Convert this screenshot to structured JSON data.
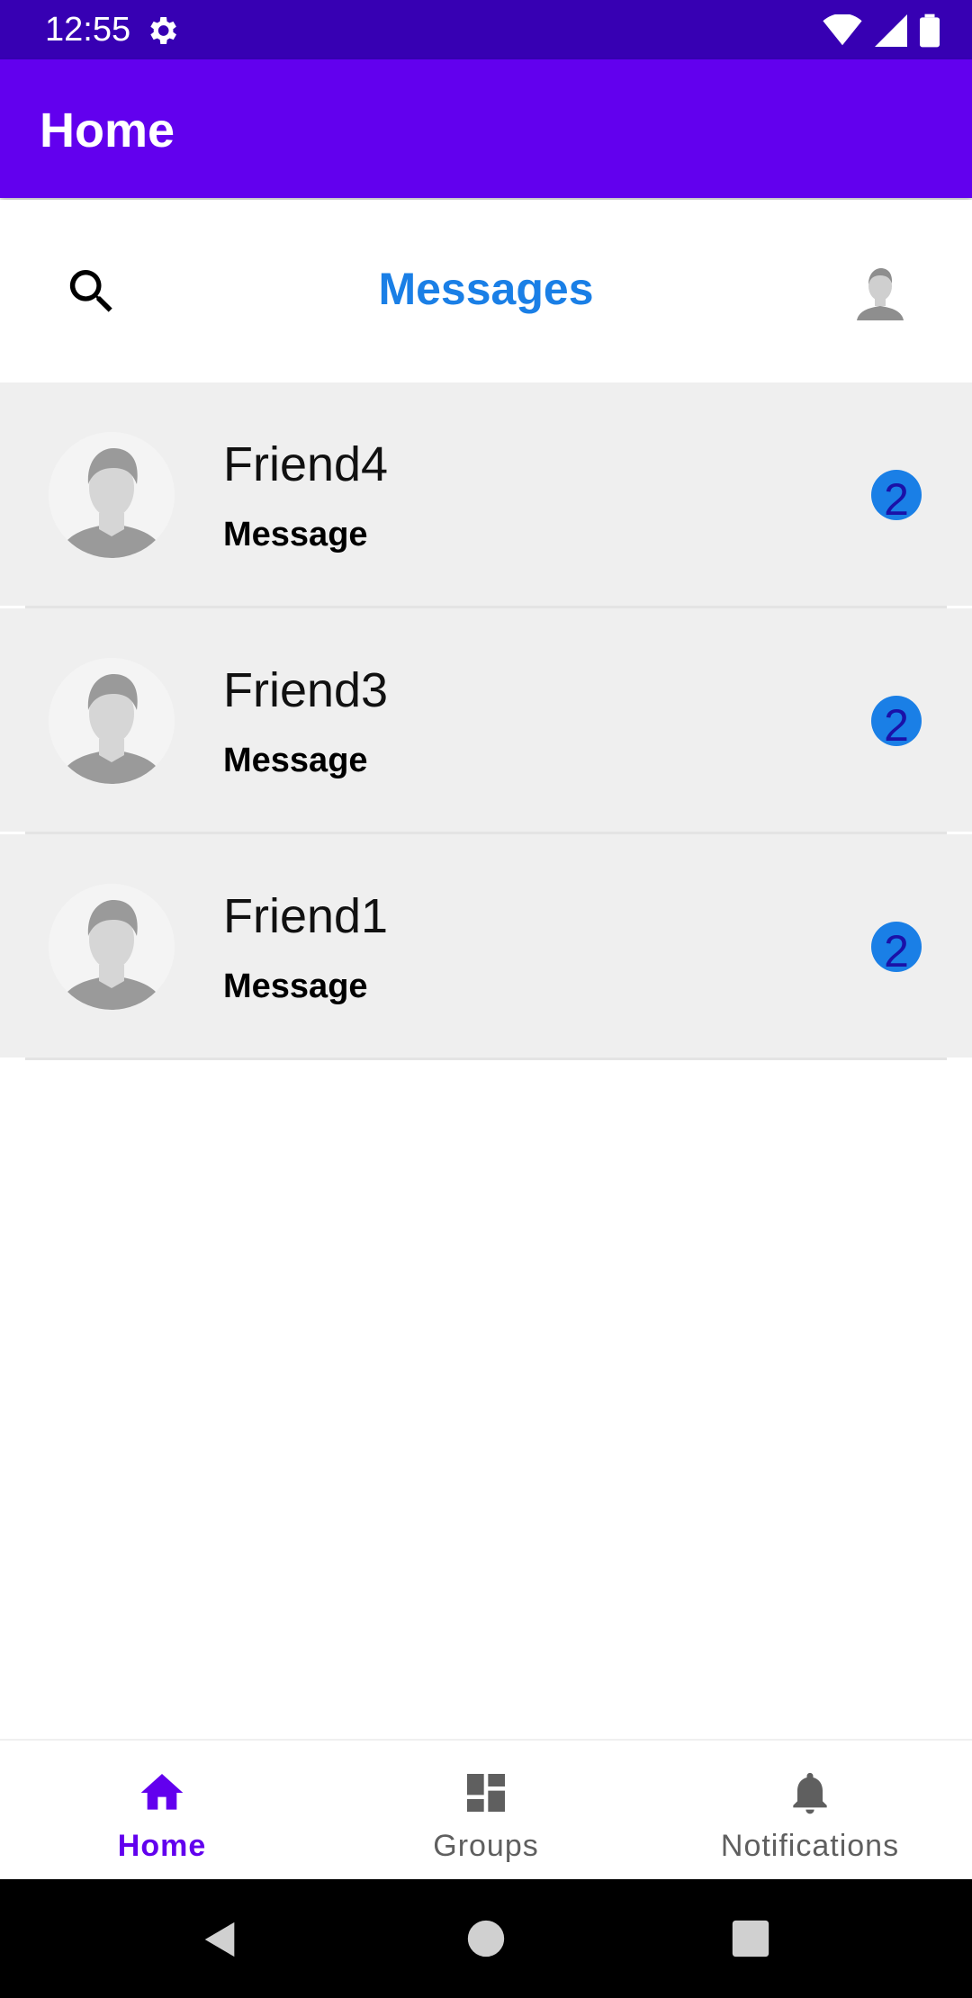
{
  "status_bar": {
    "time": "12:55"
  },
  "app_bar": {
    "title": "Home"
  },
  "toolbar": {
    "tab_title": "Messages"
  },
  "conversations": [
    {
      "name": "Friend4",
      "message": "Message",
      "unread": "2"
    },
    {
      "name": "Friend3",
      "message": "Message",
      "unread": "2"
    },
    {
      "name": "Friend1",
      "message": "Message",
      "unread": "2"
    }
  ],
  "bottom_nav": {
    "items": [
      {
        "label": "Home",
        "icon": "home-icon",
        "selected": true
      },
      {
        "label": "Groups",
        "icon": "dashboard-icon",
        "selected": false
      },
      {
        "label": "Notifications",
        "icon": "bell-icon",
        "selected": false
      }
    ]
  },
  "colors": {
    "status_bar": "#3700b3",
    "app_bar": "#6200ee",
    "accent_blue": "#1a7fe6",
    "selected_nav": "#6200ee",
    "unselected_nav": "#5f5f5f"
  }
}
